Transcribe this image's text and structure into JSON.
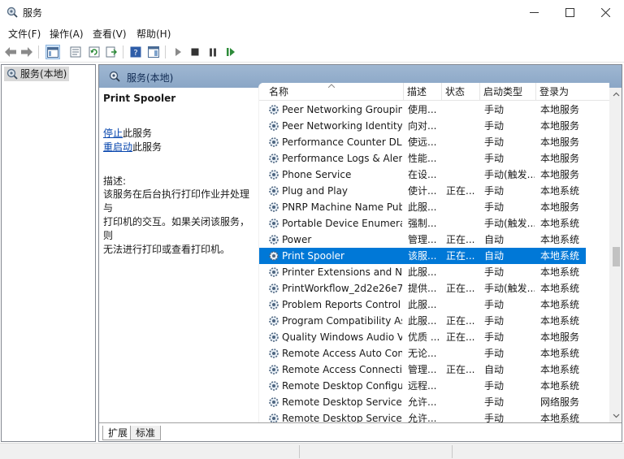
{
  "window": {
    "title": "服务",
    "icon": "gear-magnifier-icon"
  },
  "menu": [
    "文件(F)",
    "操作(A)",
    "查看(V)",
    "帮助(H)"
  ],
  "tree": {
    "root_label": "服务(本地)"
  },
  "main": {
    "header_title": "服务(本地)"
  },
  "description_pane": {
    "service_name": "Print Spooler",
    "stop_link": "停止",
    "stop_suffix": "此服务",
    "restart_link": "重启动",
    "restart_suffix": "此服务",
    "desc_label": "描述:",
    "desc_lines": [
      "该服务在后台执行打印作业并处理与",
      "打印机的交互。如果关闭该服务，则",
      "无法进行打印或查看打印机。"
    ]
  },
  "columns": [
    "名称",
    "描述",
    "状态",
    "启动类型",
    "登录为"
  ],
  "services": [
    {
      "name": "Peer Networking Grouping",
      "desc": "使用...",
      "status": "",
      "startup": "手动",
      "logon": "本地服务"
    },
    {
      "name": "Peer Networking Identity ...",
      "desc": "向对...",
      "status": "",
      "startup": "手动",
      "logon": "本地服务"
    },
    {
      "name": "Performance Counter DLL ...",
      "desc": "使远...",
      "status": "",
      "startup": "手动",
      "logon": "本地服务"
    },
    {
      "name": "Performance Logs & Alerts",
      "desc": "性能...",
      "status": "",
      "startup": "手动",
      "logon": "本地服务"
    },
    {
      "name": "Phone Service",
      "desc": "在设...",
      "status": "",
      "startup": "手动(触发...",
      "logon": "本地服务"
    },
    {
      "name": "Plug and Play",
      "desc": "使计...",
      "status": "正在...",
      "startup": "手动",
      "logon": "本地系统"
    },
    {
      "name": "PNRP Machine Name Publ...",
      "desc": "此服...",
      "status": "",
      "startup": "手动",
      "logon": "本地服务"
    },
    {
      "name": "Portable Device Enumerat...",
      "desc": "强制...",
      "status": "",
      "startup": "手动(触发...",
      "logon": "本地系统"
    },
    {
      "name": "Power",
      "desc": "管理...",
      "status": "正在...",
      "startup": "自动",
      "logon": "本地系统"
    },
    {
      "name": "Print Spooler",
      "desc": "该服...",
      "status": "正在...",
      "startup": "自动",
      "logon": "本地系统",
      "selected": true
    },
    {
      "name": "Printer Extensions and Noti...",
      "desc": "此服...",
      "status": "",
      "startup": "手动",
      "logon": "本地系统"
    },
    {
      "name": "PrintWorkflow_2d2e26e7",
      "desc": "提供...",
      "status": "正在...",
      "startup": "手动(触发...",
      "logon": "本地系统"
    },
    {
      "name": "Problem Reports Control P...",
      "desc": "此服...",
      "status": "",
      "startup": "手动",
      "logon": "本地系统"
    },
    {
      "name": "Program Compatibility Assi...",
      "desc": "此服...",
      "status": "正在...",
      "startup": "手动",
      "logon": "本地系统"
    },
    {
      "name": "Quality Windows Audio Vi...",
      "desc": "优质 ...",
      "status": "正在...",
      "startup": "手动",
      "logon": "本地服务"
    },
    {
      "name": "Remote Access Auto Conn...",
      "desc": "无论...",
      "status": "",
      "startup": "手动",
      "logon": "本地系统"
    },
    {
      "name": "Remote Access Connectio...",
      "desc": "管理...",
      "status": "正在...",
      "startup": "自动",
      "logon": "本地系统"
    },
    {
      "name": "Remote Desktop Configur...",
      "desc": "远程...",
      "status": "",
      "startup": "手动",
      "logon": "本地系统"
    },
    {
      "name": "Remote Desktop Services",
      "desc": "允许...",
      "status": "",
      "startup": "手动",
      "logon": "网络服务"
    },
    {
      "name": "Remote Desktop Services ...",
      "desc": "允许...",
      "status": "",
      "startup": "手动",
      "logon": "本地系统"
    }
  ],
  "tabs": [
    "扩展",
    "标准"
  ],
  "colors": {
    "selection": "#0078d7",
    "header": "#8aa6c6",
    "link": "#0645ad"
  }
}
